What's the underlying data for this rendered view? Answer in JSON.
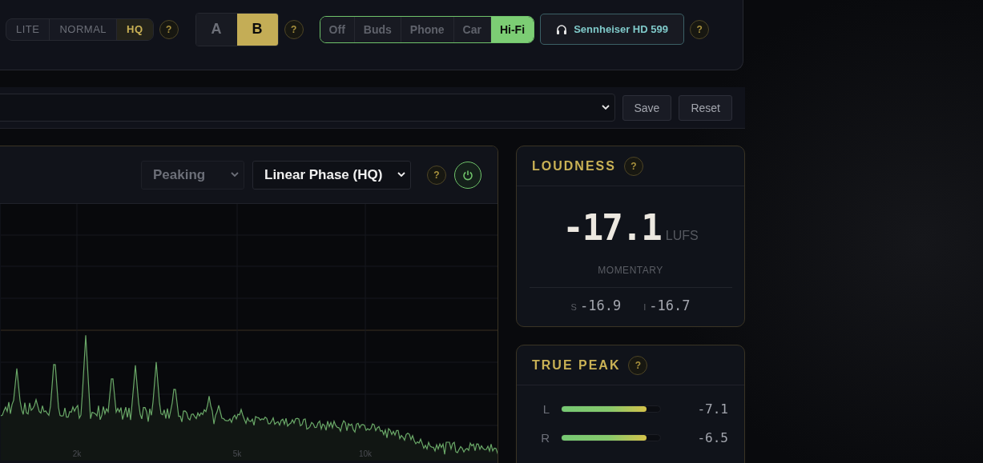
{
  "toolbar": {
    "quality_modes": [
      {
        "label": "LITE",
        "selected": false
      },
      {
        "label": "NORMAL",
        "selected": false
      },
      {
        "label": "HQ",
        "selected": true
      }
    ],
    "quality_help": "?",
    "ab_slots": [
      {
        "label": "A",
        "selected": false
      },
      {
        "label": "B",
        "selected": true
      }
    ],
    "ab_help": "?",
    "playback_targets": [
      {
        "label": "Off",
        "selected": false
      },
      {
        "label": "Buds",
        "selected": false
      },
      {
        "label": "Phone",
        "selected": false
      },
      {
        "label": "Car",
        "selected": false
      },
      {
        "label": "Hi-Fi",
        "selected": true
      }
    ],
    "headphone": "Sennheiser HD 599",
    "headphone_help": "?"
  },
  "preset_bar": {
    "buttons": [
      "Save",
      "Reset"
    ]
  },
  "eq_panel": {
    "filter_type": {
      "value": "Peaking",
      "disabled": true
    },
    "phase_mode": {
      "value": "Linear Phase (HQ)",
      "disabled": false
    },
    "help": "?",
    "power_on": true,
    "spectrum": {
      "x_labels": [
        "2k",
        "5k",
        "10k"
      ]
    }
  },
  "loudness": {
    "title": "LOUDNESS",
    "help": "?",
    "value": "-17.1",
    "unit": "LUFS",
    "mode": "MOMENTARY",
    "readings": [
      {
        "label": "S",
        "value": "-16.9"
      },
      {
        "label": "I",
        "value": "-16.7"
      }
    ]
  },
  "true_peak": {
    "title": "TRUE PEAK",
    "help": "?",
    "channels": [
      {
        "label": "L",
        "level": 0.86,
        "reading": "-7.1"
      },
      {
        "label": "R",
        "level": 0.86,
        "reading": "-6.5"
      }
    ]
  }
}
